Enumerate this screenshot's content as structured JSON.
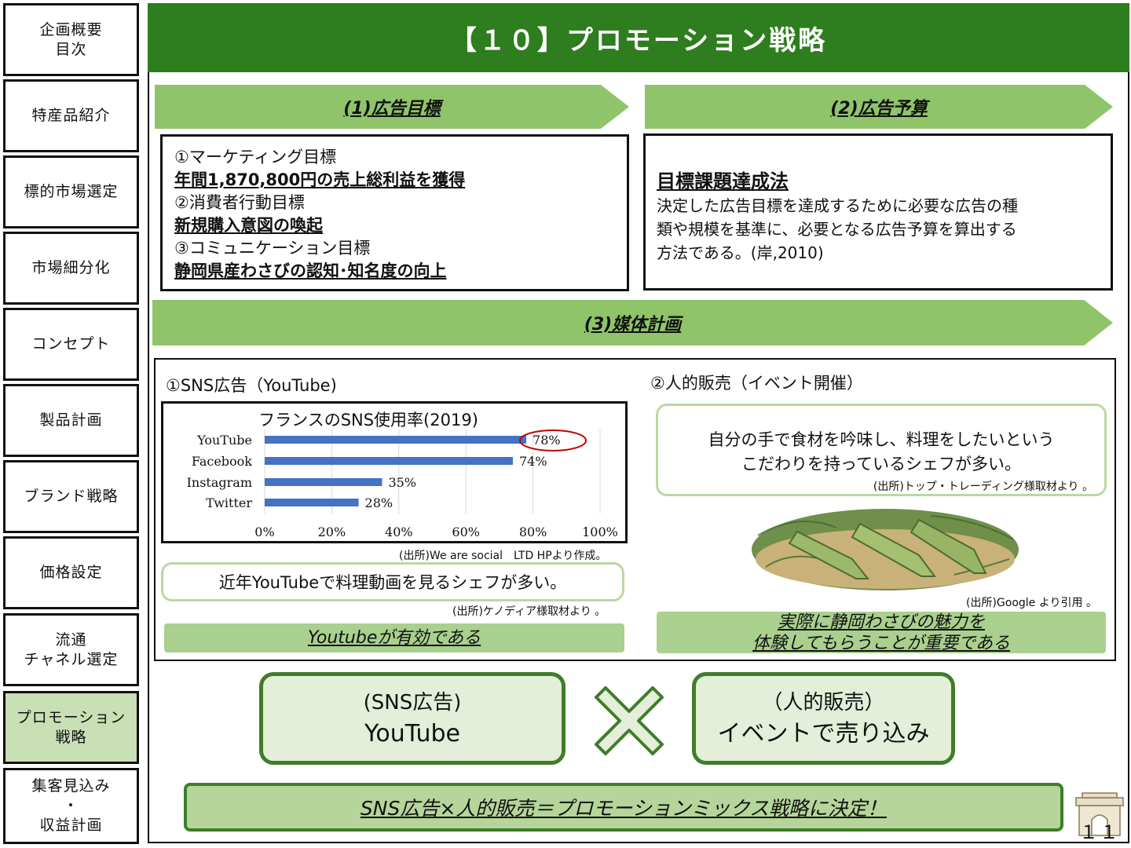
{
  "sidebar": {
    "items": [
      {
        "label": "企画概要\n目次"
      },
      {
        "label": "特産品紹介"
      },
      {
        "label": "標的市場選定"
      },
      {
        "label": "市場細分化"
      },
      {
        "label": "コンセプト"
      },
      {
        "label": "製品計画"
      },
      {
        "label": "ブランド戦略"
      },
      {
        "label": "価格設定"
      },
      {
        "label": "流通\nチャネル選定"
      },
      {
        "label": "プロモーション\n戦略"
      },
      {
        "label": "集客見込み\n・\n収益計画"
      }
    ],
    "active_index": 9
  },
  "title": "【１０】プロモーション戦略",
  "section1": {
    "heading": "(1)広告目標",
    "lines": [
      "①マーケティング目標",
      "年間1,870,800円の売上総利益を獲得",
      "②消費者行動目標",
      "新規購入意図の喚起",
      "③コミュニケーション目標",
      "静岡県産わさびの認知･知名度の向上"
    ]
  },
  "section2": {
    "heading": "(2)広告予算",
    "subheading": "目標課題達成法",
    "lines": [
      "決定した広告目標を達成するために必要な広告の種",
      "類や規模を基準に、必要となる広告予算を算出する",
      "方法である。(岸,2010)"
    ]
  },
  "section3": {
    "heading": "(3)媒体計画",
    "left": {
      "title": "①SNS広告（YouTube)",
      "source": "(出所)We are social　LTD HPより作成。",
      "callout": "近年YouTubeで料理動画を見るシェフが多い。",
      "callout_source": "(出所)ケノディア様取材より 。",
      "conclusion": "Youtubeが有効である"
    },
    "right": {
      "title": "②人的販売（イベント開催）",
      "callout_lines": [
        "自分の手で食材を吟味し、料理をしたいという",
        "こだわりを持っているシェフが多い。"
      ],
      "callout_source": "(出所)トップ・トレーディング様取材より 。",
      "image_source": "(出所)Google より引用 。",
      "conclusion_lines": [
        "実際に静岡わさびの魅力を",
        "体験してもらうことが重要である"
      ]
    }
  },
  "chart_data": {
    "type": "bar",
    "orientation": "horizontal",
    "title": "フランスのSNS使用率(2019)",
    "categories": [
      "YouTube",
      "Facebook",
      "Instagram",
      "Twitter"
    ],
    "values": [
      78,
      74,
      35,
      28
    ],
    "value_labels": [
      "78%",
      "74%",
      "35%",
      "28%"
    ],
    "xlim": [
      0,
      100
    ],
    "ticks": [
      "0%",
      "20%",
      "40%",
      "60%",
      "80%",
      "100%"
    ],
    "bar_color": "#4472c4",
    "highlight": "YouTube",
    "highlight_color": "#c00000",
    "grid": true
  },
  "mix": {
    "left_lines": [
      "(SNS広告)",
      "YouTube"
    ],
    "right_lines": [
      "（人的販売）",
      "イベントで売り込み"
    ],
    "conclusion": "SNS広告×人的販売＝プロモーションミックス戦略に決定！"
  },
  "page_number": "１１",
  "colors": {
    "title_bg": "#2e7d1e",
    "arrow": "#8fc46a",
    "active_sidebar": "#c9dfb5"
  }
}
